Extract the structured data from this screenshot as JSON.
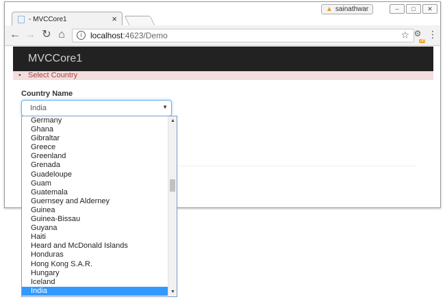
{
  "browser": {
    "tab_title": "- MVCCore1",
    "tab_close": "×",
    "profile_name": "sainathwar",
    "url_host": "localhost",
    "url_path": ":4623/Demo",
    "icons": [
      "back-arrow-icon",
      "forward-arrow-icon",
      "reload-icon",
      "home-icon",
      "info-icon",
      "star-icon",
      "extension-icon",
      "menu-dots-icon",
      "warning-icon"
    ],
    "window_buttons": [
      "–",
      "□",
      "✕"
    ]
  },
  "page": {
    "brand": "MVCCore1",
    "validation_message": "Select Country",
    "field_label": "Country Name",
    "selected_country": "India"
  },
  "dropdown": {
    "options": [
      "Germany",
      "Ghana",
      "Gibraltar",
      "Greece",
      "Greenland",
      "Grenada",
      "Guadeloupe",
      "Guam",
      "Guatemala",
      "Guernsey and Alderney",
      "Guinea",
      "Guinea-Bissau",
      "Guyana",
      "Haiti",
      "Heard and McDonald Islands",
      "Honduras",
      "Hong Kong S.A.R.",
      "Hungary",
      "Iceland",
      "India"
    ],
    "selected_index": 19
  }
}
